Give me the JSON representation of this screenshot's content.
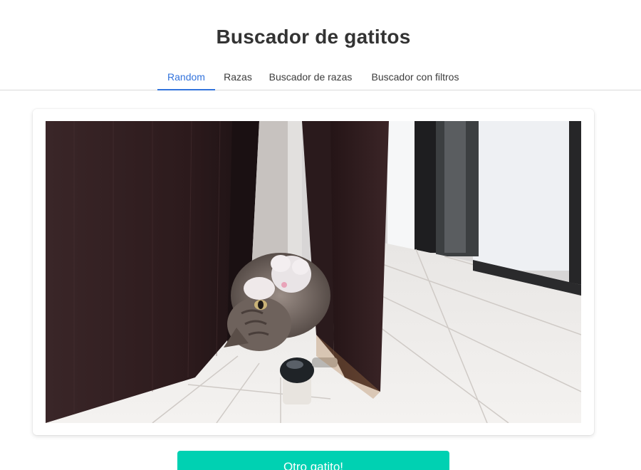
{
  "header": {
    "title": "Buscador de gatitos"
  },
  "tabs": [
    {
      "label": "Random",
      "active": true
    },
    {
      "label": "Razas",
      "active": false
    },
    {
      "label": "Buscador de razas",
      "active": false
    },
    {
      "label": "Buscador con filtros",
      "active": false
    }
  ],
  "main": {
    "image_subject": "cat lying upside down beside a dark door",
    "action_button_label": "Otro gatito!"
  },
  "colors": {
    "accent": "#3273dc",
    "button": "#00d1b2"
  }
}
